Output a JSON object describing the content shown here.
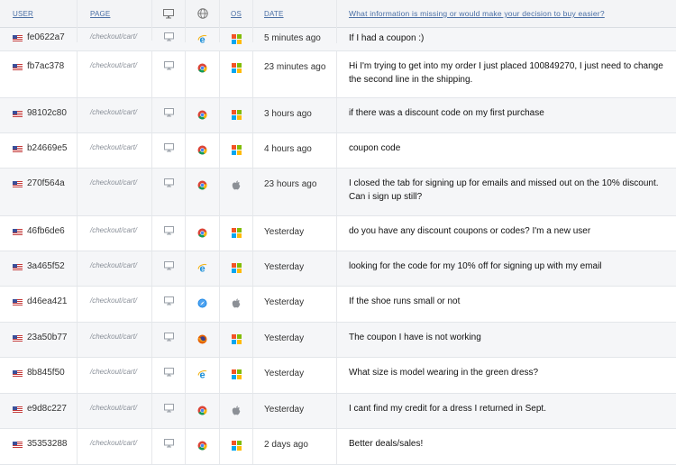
{
  "header": {
    "user": "USER",
    "page": "PAGE",
    "os": "OS",
    "date": "DATE",
    "question": "What information is missing or would make your decision to buy easier?",
    "device_icon": "monitor-icon",
    "browser_icon": "globe-icon"
  },
  "rows": [
    {
      "user": "fe0622a7",
      "page": "/checkout/cart/",
      "device": "desktop",
      "browser": "ie",
      "os": "windows",
      "date": "5 minutes ago",
      "message": "If I had a coupon :)"
    },
    {
      "user": "fb7ac378",
      "page": "/checkout/cart/",
      "device": "desktop",
      "browser": "chrome",
      "os": "windows",
      "date": "23 minutes ago",
      "message": "Hi I'm trying to get into my order I just placed 100849270, I just need to change the second line in the shipping."
    },
    {
      "user": "98102c80",
      "page": "/checkout/cart/",
      "device": "desktop",
      "browser": "chrome",
      "os": "windows",
      "date": "3 hours ago",
      "message": "if there was a discount code on my first purchase"
    },
    {
      "user": "b24669e5",
      "page": "/checkout/cart/",
      "device": "desktop",
      "browser": "chrome",
      "os": "windows",
      "date": "4 hours ago",
      "message": "coupon code"
    },
    {
      "user": "270f564a",
      "page": "/checkout/cart/",
      "device": "desktop",
      "browser": "chrome",
      "os": "apple",
      "date": "23 hours ago",
      "message": "I closed the tab for signing up for emails and missed out on the 10% discount. Can i sign up still?"
    },
    {
      "user": "46fb6de6",
      "page": "/checkout/cart/",
      "device": "desktop",
      "browser": "chrome",
      "os": "windows",
      "date": "Yesterday",
      "message": "do you have any discount coupons or codes? I'm a new user"
    },
    {
      "user": "3a465f52",
      "page": "/checkout/cart/",
      "device": "desktop",
      "browser": "ie",
      "os": "windows",
      "date": "Yesterday",
      "message": "looking for the code for my 10% off for signing up with my email"
    },
    {
      "user": "d46ea421",
      "page": "/checkout/cart/",
      "device": "desktop",
      "browser": "safari",
      "os": "apple",
      "date": "Yesterday",
      "message": "If the shoe runs small or not"
    },
    {
      "user": "23a50b77",
      "page": "/checkout/cart/",
      "device": "desktop",
      "browser": "firefox",
      "os": "windows",
      "date": "Yesterday",
      "message": "The coupon I have is not working"
    },
    {
      "user": "8b845f50",
      "page": "/checkout/cart/",
      "device": "desktop",
      "browser": "ie",
      "os": "windows",
      "date": "Yesterday",
      "message": "What size is model wearing in the green dress?"
    },
    {
      "user": "e9d8c227",
      "page": "/checkout/cart/",
      "device": "desktop",
      "browser": "chrome",
      "os": "apple",
      "date": "Yesterday",
      "message": "I cant find my credit for a dress I returned in Sept."
    },
    {
      "user": "35353288",
      "page": "/checkout/cart/",
      "device": "desktop",
      "browser": "chrome",
      "os": "windows",
      "date": "2 days ago",
      "message": "Better deals/sales!"
    }
  ]
}
